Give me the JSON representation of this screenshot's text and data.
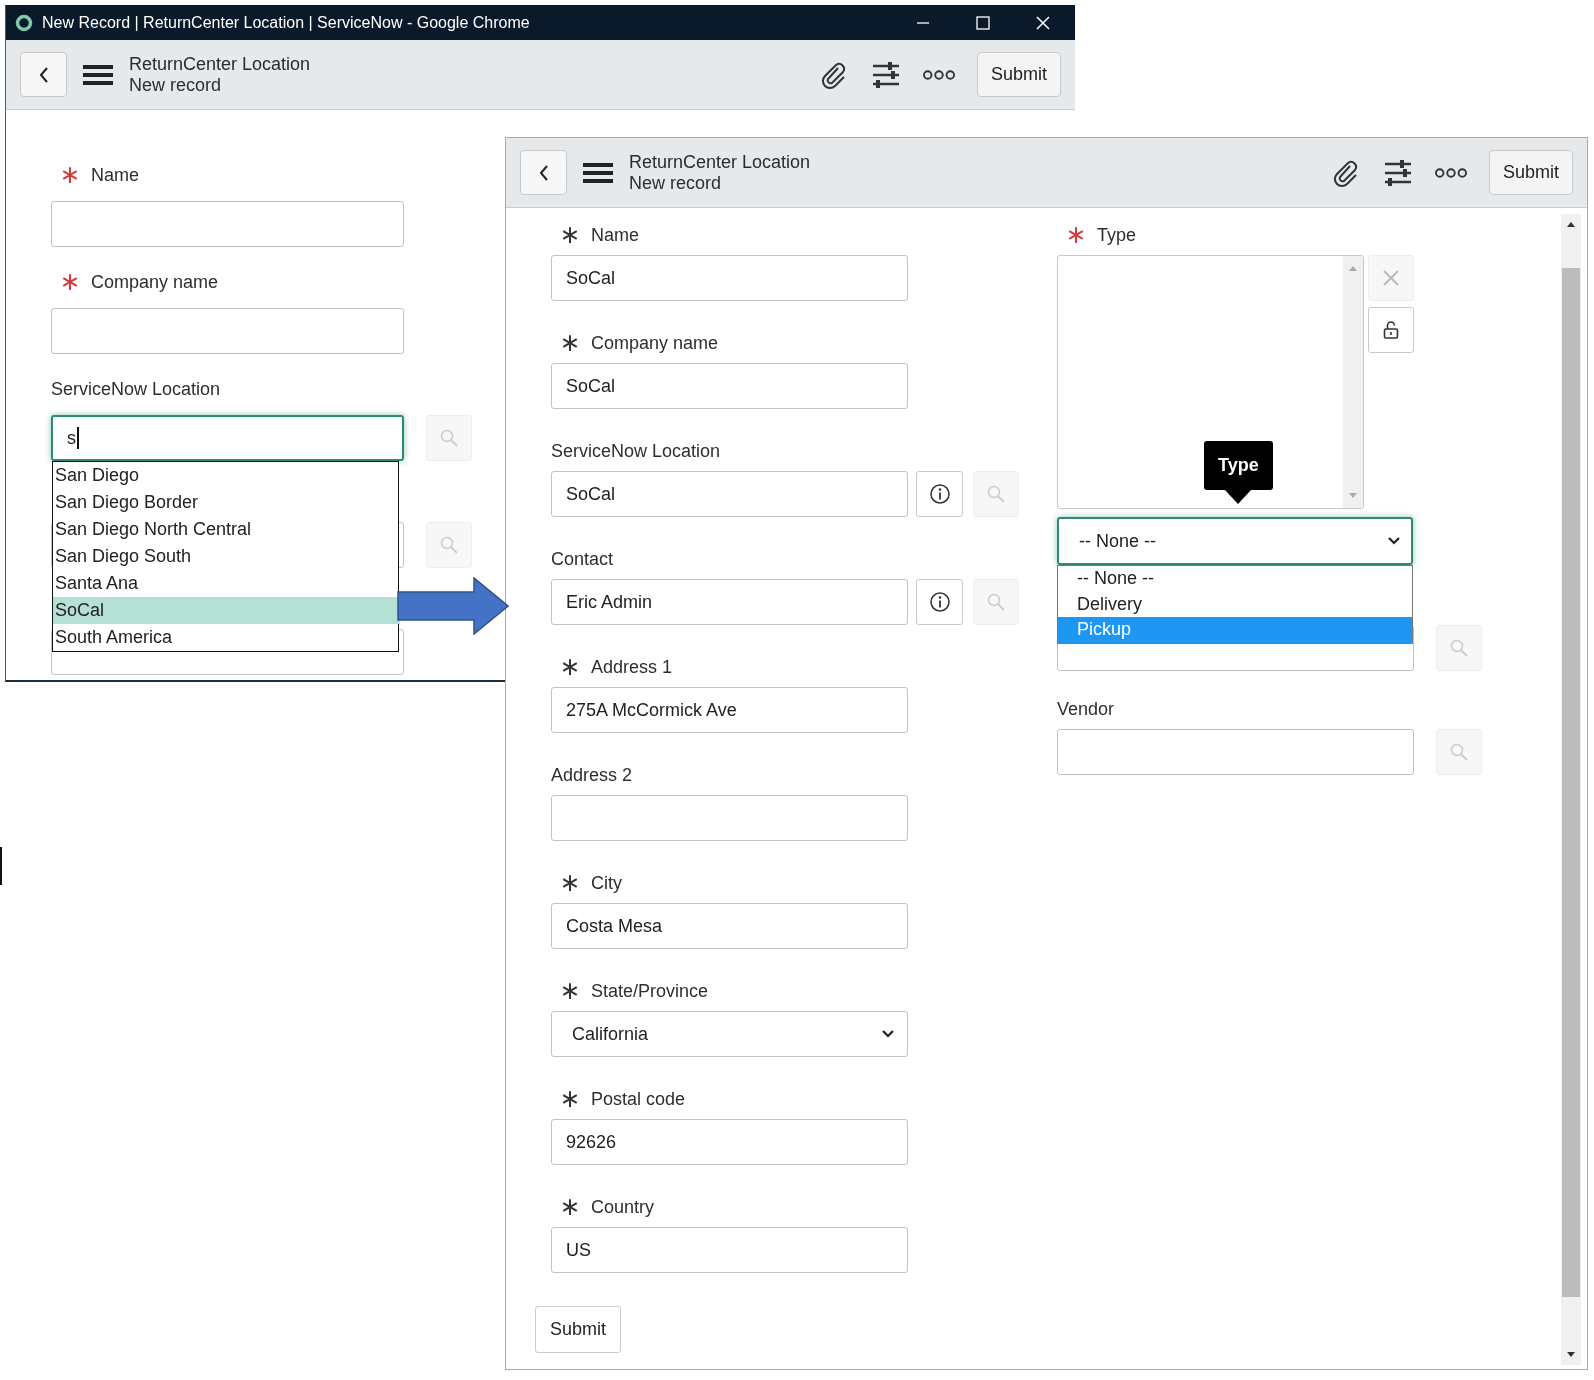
{
  "back_window": {
    "title": "New Record | ReturnCenter Location | ServiceNow - Google Chrome",
    "header": {
      "title": "ReturnCenter Location",
      "subtitle": "New record",
      "submit": "Submit"
    },
    "fields": [
      {
        "label": "Name",
        "required": true,
        "missing": true,
        "kind": "text"
      },
      {
        "label": "Company name",
        "required": true,
        "missing": true,
        "kind": "text"
      },
      {
        "label": "ServiceNow Location",
        "kind": "reference",
        "value": "s",
        "focused": true
      },
      {
        "kind": "reference"
      },
      {
        "kind": "text"
      }
    ],
    "suggestions": [
      {
        "label": "San Diego",
        "selected": false
      },
      {
        "label": "San Diego Border",
        "selected": false
      },
      {
        "label": "San Diego North Central",
        "selected": false
      },
      {
        "label": "San Diego South",
        "selected": false
      },
      {
        "label": "Santa Ana",
        "selected": false
      },
      {
        "label": "SoCal",
        "selected": true
      },
      {
        "label": "South America",
        "selected": false
      }
    ]
  },
  "front_window": {
    "header": {
      "title": "ReturnCenter Location",
      "subtitle": "New record",
      "submit": "Submit"
    },
    "left_fields": [
      {
        "label": "Name",
        "required": true,
        "missing": false,
        "kind": "text",
        "value": "SoCal"
      },
      {
        "label": "Company name",
        "required": true,
        "missing": false,
        "kind": "text",
        "value": "SoCal"
      },
      {
        "label": "ServiceNow Location",
        "kind": "reference",
        "value": "SoCal",
        "info_button": true
      },
      {
        "label": "Contact",
        "kind": "reference",
        "value": "Eric Admin",
        "info_button": true
      },
      {
        "label": "Address 1",
        "required": true,
        "missing": false,
        "kind": "text",
        "value": "275A McCormick Ave"
      },
      {
        "label": "Address 2",
        "kind": "text"
      },
      {
        "label": "City",
        "required": true,
        "missing": false,
        "kind": "text",
        "value": "Costa Mesa"
      },
      {
        "label": "State/Province",
        "required": true,
        "missing": false,
        "kind": "select",
        "value": "California"
      },
      {
        "label": "Postal code",
        "required": true,
        "missing": false,
        "kind": "text",
        "value": "92626"
      },
      {
        "label": "Country",
        "required": true,
        "missing": false,
        "kind": "text",
        "value": "US"
      }
    ],
    "type_field": {
      "label": "Type",
      "required": true,
      "missing": true,
      "tooltip": "Type",
      "select_value": "-- None --",
      "options": [
        {
          "label": "-- None --",
          "selected": false
        },
        {
          "label": "Delivery",
          "selected": false
        },
        {
          "label": "Pickup",
          "selected": true
        }
      ]
    },
    "right_fields": [
      {
        "kind": "reference"
      },
      {
        "label": "Vendor",
        "kind": "reference"
      }
    ],
    "submit": "Submit"
  }
}
